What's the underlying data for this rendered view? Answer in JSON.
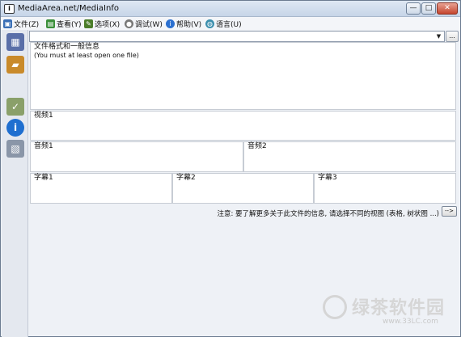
{
  "window": {
    "title": "MediaArea.net/MediaInfo",
    "min_glyph": "—",
    "max_glyph": "□",
    "close_glyph": "✕"
  },
  "menu": [
    {
      "label": "文件(Z)",
      "icon": "file-icon",
      "color": "#3a6fb6"
    },
    {
      "label": "查看(Y)",
      "icon": "view-icon",
      "color": "#3b8f3b"
    },
    {
      "label": "选项(X)",
      "icon": "options-icon",
      "color": "#4b7d2a"
    },
    {
      "label": "调试(W)",
      "icon": "debug-icon",
      "color": "#777777"
    },
    {
      "label": "帮助(V)",
      "icon": "help-icon",
      "color": "#2a6fd0"
    },
    {
      "label": "语言(U)",
      "icon": "language-icon",
      "color": "#3c8fae"
    }
  ],
  "file_combo": {
    "value": "",
    "arrow": "▼"
  },
  "browse_label": "...",
  "panels": {
    "general": {
      "label": "文件格式和一般信息",
      "note": "(You must at least open one file)"
    },
    "video1": {
      "label": "视频1"
    },
    "audio1": {
      "label": "音频1"
    },
    "audio2": {
      "label": "音频2"
    },
    "text1": {
      "label": "字幕1"
    },
    "text2": {
      "label": "字幕2"
    },
    "text3": {
      "label": "字幕3"
    }
  },
  "notice": "注意: 要了解更多关于此文件的信息, 请选择不同的视图 (表格, 树状图 ...)",
  "next_button": "-->",
  "watermark": {
    "text": "绿茶软件园",
    "url": "www.33LC.com"
  }
}
